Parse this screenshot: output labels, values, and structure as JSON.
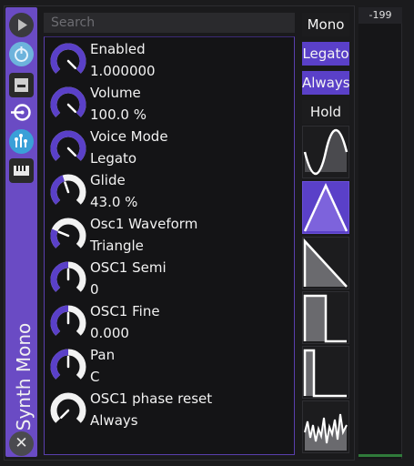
{
  "plugin": {
    "title": "Synth Mono"
  },
  "search": {
    "placeholder": "Search"
  },
  "sidebar": {
    "buttons": [
      {
        "name": "play-icon"
      },
      {
        "name": "power-icon"
      },
      {
        "name": "save-icon"
      },
      {
        "name": "routing-icon"
      },
      {
        "name": "automation-icon"
      },
      {
        "name": "keyboard-icon"
      }
    ],
    "close_glyph": "✕"
  },
  "params": [
    {
      "name": "Enabled",
      "value": "1.000000",
      "level": 1.0
    },
    {
      "name": "Volume",
      "value": "100.0 %",
      "level": 1.0
    },
    {
      "name": "Voice Mode",
      "value": "Legato",
      "level": 1.0
    },
    {
      "name": "Glide",
      "value": "43.0 %",
      "level": 0.43
    },
    {
      "name": "Osc1 Waveform",
      "value": "Triangle",
      "level": 0.25
    },
    {
      "name": "OSC1 Semi",
      "value": "0",
      "level": 0.5
    },
    {
      "name": "OSC1 Fine",
      "value": "0.000",
      "level": 0.5
    },
    {
      "name": "Pan",
      "value": "C",
      "level": 0.5
    },
    {
      "name": "OSC1 phase reset",
      "value": "Always",
      "level": 0.0
    }
  ],
  "mode_buttons": [
    {
      "label": "Mono",
      "active": false
    },
    {
      "label": "Legato",
      "active": true
    },
    {
      "label": "Always",
      "active": true
    },
    {
      "label": "Hold",
      "active": false
    }
  ],
  "waveforms": [
    {
      "name": "sine",
      "active": false
    },
    {
      "name": "triangle",
      "active": true
    },
    {
      "name": "saw",
      "active": false
    },
    {
      "name": "square",
      "active": false
    },
    {
      "name": "pulse",
      "active": false
    },
    {
      "name": "noise",
      "active": false
    }
  ],
  "meter": {
    "readout": "-199"
  },
  "colors": {
    "accent": "#5a40c8",
    "strip": "#6a4bc4",
    "knob_arc": "#5a40c8"
  }
}
